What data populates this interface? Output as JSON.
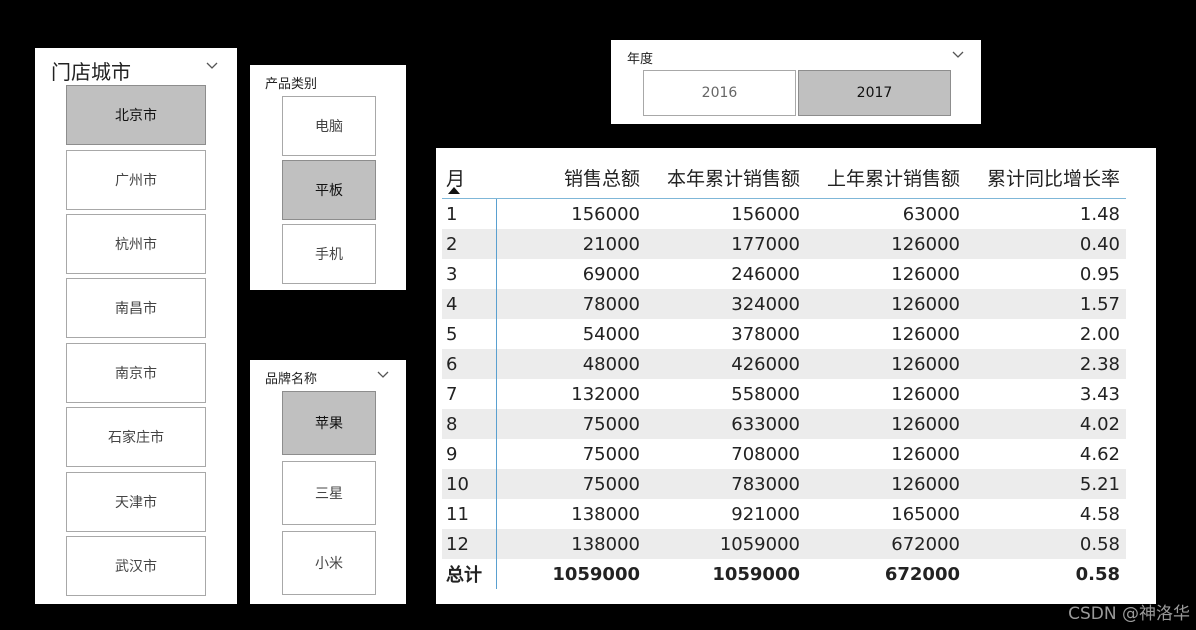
{
  "city_slicer": {
    "title": "门店城市",
    "items": [
      {
        "label": "北京市",
        "selected": true
      },
      {
        "label": "广州市",
        "selected": false
      },
      {
        "label": "杭州市",
        "selected": false
      },
      {
        "label": "南昌市",
        "selected": false
      },
      {
        "label": "南京市",
        "selected": false
      },
      {
        "label": "石家庄市",
        "selected": false
      },
      {
        "label": "天津市",
        "selected": false
      },
      {
        "label": "武汉市",
        "selected": false
      }
    ]
  },
  "category_slicer": {
    "title": "产品类别",
    "items": [
      {
        "label": "电脑",
        "selected": false
      },
      {
        "label": "平板",
        "selected": true
      },
      {
        "label": "手机",
        "selected": false
      }
    ]
  },
  "brand_slicer": {
    "title": "品牌名称",
    "items": [
      {
        "label": "苹果",
        "selected": true
      },
      {
        "label": "三星",
        "selected": false
      },
      {
        "label": "小米",
        "selected": false
      }
    ]
  },
  "year_slicer": {
    "title": "年度",
    "items": [
      {
        "label": "2016",
        "selected": false
      },
      {
        "label": "2017",
        "selected": true
      }
    ]
  },
  "matrix": {
    "headers": [
      "月",
      "销售总额",
      "本年累计销售额",
      "上年累计销售额",
      "累计同比增长率"
    ],
    "rows": [
      [
        "1",
        "156000",
        "156000",
        "63000",
        "1.48"
      ],
      [
        "2",
        "21000",
        "177000",
        "126000",
        "0.40"
      ],
      [
        "3",
        "69000",
        "246000",
        "126000",
        "0.95"
      ],
      [
        "4",
        "78000",
        "324000",
        "126000",
        "1.57"
      ],
      [
        "5",
        "54000",
        "378000",
        "126000",
        "2.00"
      ],
      [
        "6",
        "48000",
        "426000",
        "126000",
        "2.38"
      ],
      [
        "7",
        "132000",
        "558000",
        "126000",
        "3.43"
      ],
      [
        "8",
        "75000",
        "633000",
        "126000",
        "4.02"
      ],
      [
        "9",
        "75000",
        "708000",
        "126000",
        "4.62"
      ],
      [
        "10",
        "75000",
        "783000",
        "126000",
        "5.21"
      ],
      [
        "11",
        "138000",
        "921000",
        "165000",
        "4.58"
      ],
      [
        "12",
        "138000",
        "1059000",
        "672000",
        "0.58"
      ]
    ],
    "total": [
      "总计",
      "1059000",
      "1059000",
      "672000",
      "0.58"
    ]
  },
  "watermark": "CSDN @神洛华",
  "colors": {
    "background": "#000000",
    "selected_button": "#c0c0c0",
    "row_stripe": "#ececec",
    "accent_line": "#5aa0d0"
  }
}
